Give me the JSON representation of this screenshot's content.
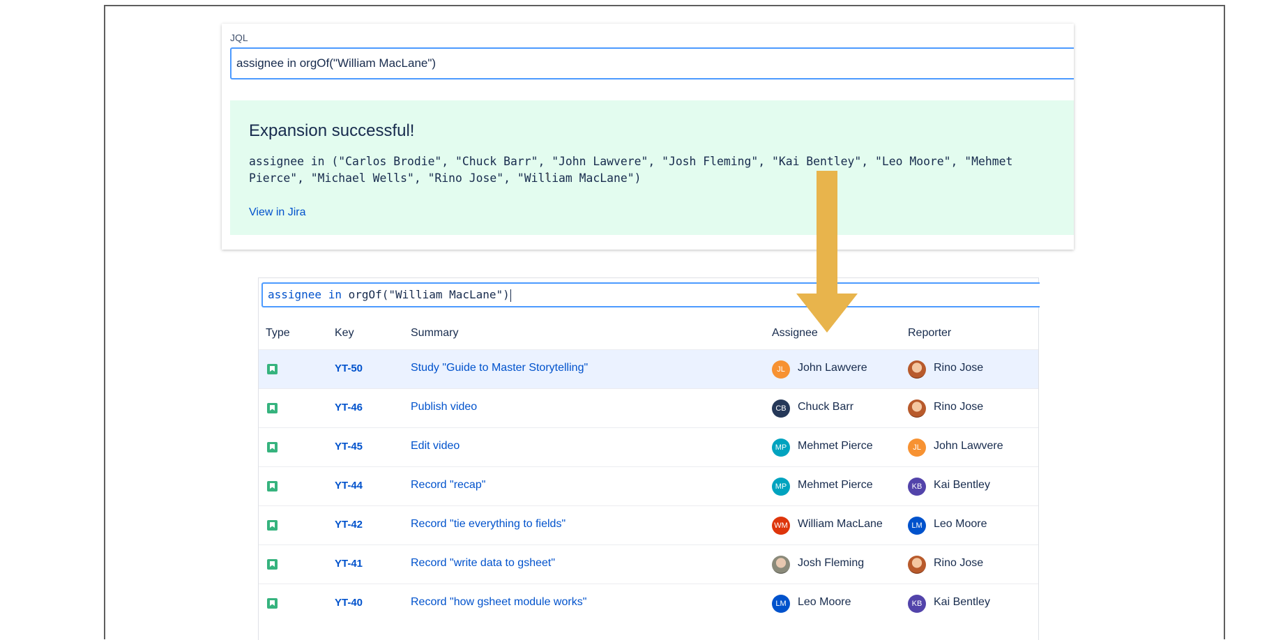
{
  "jql": {
    "label": "JQL",
    "query": "assignee in orgOf(\"William MacLane\")"
  },
  "result": {
    "title": "Expansion successful!",
    "expanded": "assignee in (\"Carlos Brodie\", \"Chuck Barr\", \"John Lawvere\", \"Josh Fleming\", \"Kai Bentley\", \"Leo Moore\", \"Mehmet Pierce\", \"Michael Wells\", \"Rino Jose\", \"William MacLane\")",
    "link": "View in Jira"
  },
  "search": {
    "kw1": "assignee",
    "kw2": "in",
    "fn": "orgOf(\"William MacLane\")"
  },
  "table": {
    "headers": {
      "type": "Type",
      "key": "Key",
      "summary": "Summary",
      "assignee": "Assignee",
      "reporter": "Reporter"
    },
    "rows": [
      {
        "key": "YT-50",
        "summary": "Study \"Guide to Master Storytelling\"",
        "assignee": "John Lawvere",
        "assignee_initials": "JL",
        "reporter": "Rino Jose",
        "reporter_initials": ""
      },
      {
        "key": "YT-46",
        "summary": "Publish video",
        "assignee": "Chuck Barr",
        "assignee_initials": "CB",
        "reporter": "Rino Jose",
        "reporter_initials": ""
      },
      {
        "key": "YT-45",
        "summary": "Edit video",
        "assignee": "Mehmet Pierce",
        "assignee_initials": "MP",
        "reporter": "John Lawvere",
        "reporter_initials": "JL"
      },
      {
        "key": "YT-44",
        "summary": "Record \"recap\"",
        "assignee": "Mehmet Pierce",
        "assignee_initials": "MP",
        "reporter": "Kai Bentley",
        "reporter_initials": "KB"
      },
      {
        "key": "YT-42",
        "summary": "Record \"tie everything to fields\"",
        "assignee": "William MacLane",
        "assignee_initials": "WM",
        "reporter": "Leo Moore",
        "reporter_initials": "LM"
      },
      {
        "key": "YT-41",
        "summary": "Record \"write data to gsheet\"",
        "assignee": "Josh Fleming",
        "assignee_initials": "",
        "reporter": "Rino Jose",
        "reporter_initials": ""
      },
      {
        "key": "YT-40",
        "summary": "Record \"how gsheet module works\"",
        "assignee": "Leo Moore",
        "assignee_initials": "LM",
        "reporter": "Kai Bentley",
        "reporter_initials": "KB"
      }
    ]
  },
  "colors": {
    "accent": "#0052cc",
    "success_bg": "#e3fcef",
    "arrow": "#e8b44c",
    "avatar_JL": "#f79232",
    "avatar_CB": "#253858",
    "avatar_MP": "#00a3bf",
    "avatar_KB": "#5243aa",
    "avatar_LM": "#0052cc",
    "avatar_WM": "#de350b"
  },
  "icons": {
    "issue_type": "story-bookmark-icon",
    "arrow": "down-arrow-icon"
  }
}
